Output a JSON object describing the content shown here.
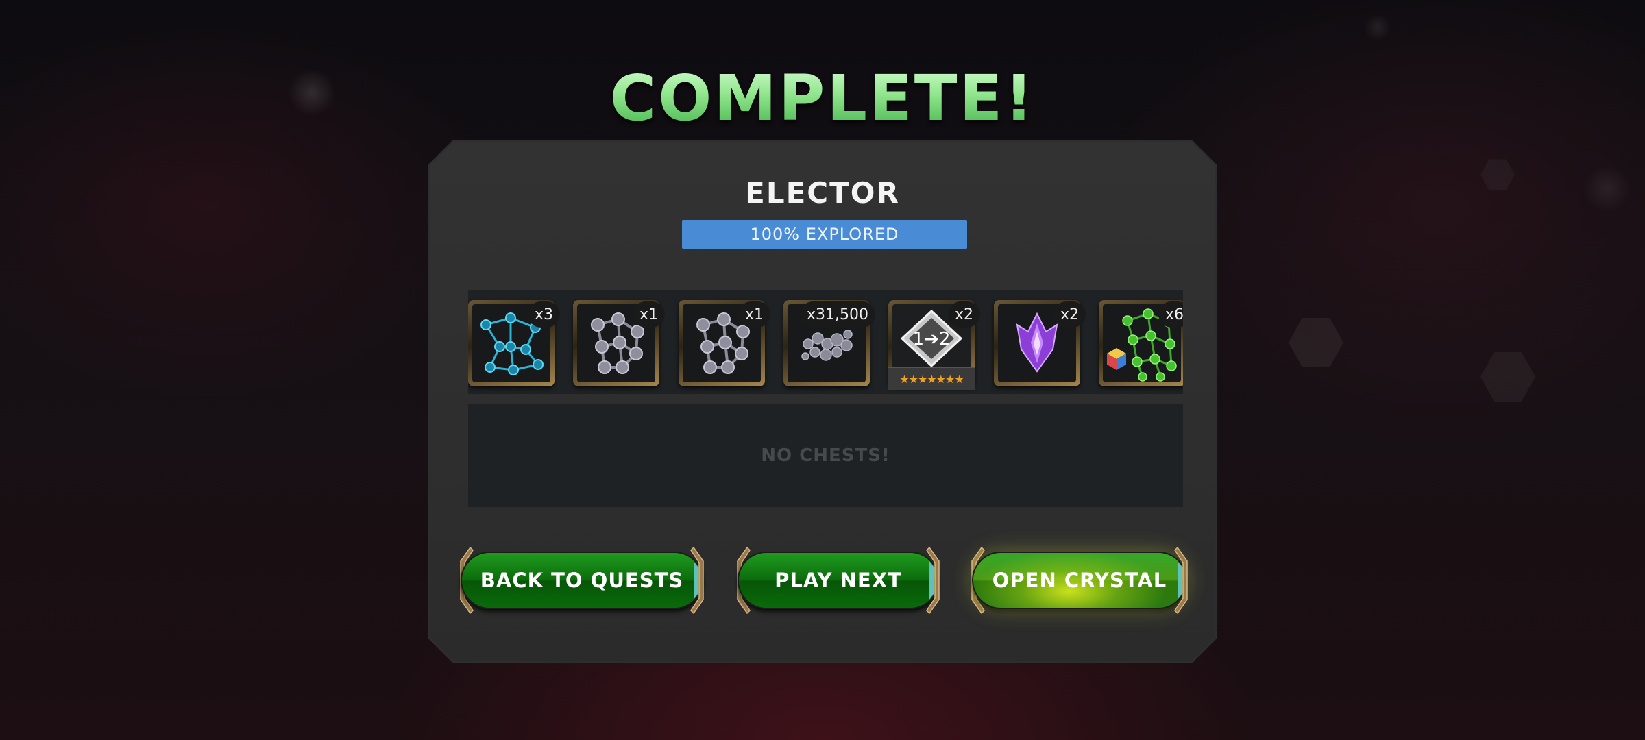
{
  "title": "COMPLETE!",
  "quest": {
    "name": "ELECTOR",
    "progress_label": "100% EXPLORED",
    "progress_fraction": 1.0
  },
  "rewards": [
    {
      "icon": "cyan-catalyst-icon",
      "count": "x3",
      "color": "#29b5d8"
    },
    {
      "icon": "gray-catalyst-icon",
      "count": "x1",
      "color": "#a9a9b8"
    },
    {
      "icon": "gray-catalyst-icon",
      "count": "x1",
      "color": "#a9a9b8"
    },
    {
      "icon": "iso-orbs-icon",
      "count": "x31,500",
      "color": "#9a9aa8"
    },
    {
      "icon": "rank-up-gem-icon",
      "label": "1➔2",
      "count": "x2",
      "stars": "★★★★★★★"
    },
    {
      "icon": "purple-crystal-shard-icon",
      "count": "x2",
      "color": "#a247e6"
    },
    {
      "icon": "green-catalyst-icon",
      "count": "x6",
      "color": "#4fc833"
    }
  ],
  "chests": {
    "empty_label": "NO CHESTS!"
  },
  "buttons": {
    "back": "BACK TO QUESTS",
    "next": "PLAY NEXT",
    "crystal": "OPEN CRYSTAL"
  },
  "colors": {
    "title_green": "#8fe58b",
    "progress_blue": "#3d7ec9",
    "button_green": "#0d6e0d",
    "crystal_glow": "#d2e61e"
  }
}
